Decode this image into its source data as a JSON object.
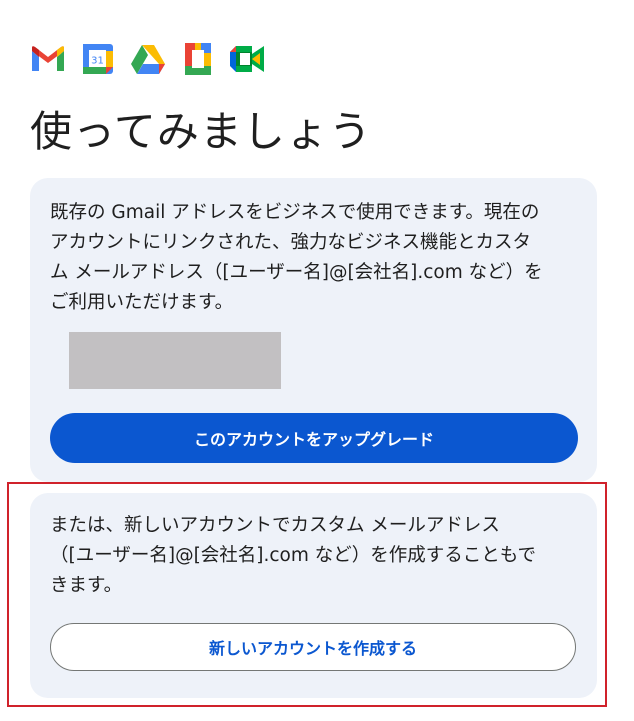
{
  "logos": [
    {
      "name": "gmail-icon"
    },
    {
      "name": "calendar-icon",
      "label": "31"
    },
    {
      "name": "drive-icon"
    },
    {
      "name": "docs-icon"
    },
    {
      "name": "meet-icon"
    }
  ],
  "page_title": "使ってみましょう",
  "upgrade_card": {
    "lines": [
      "既存の Gmail アドレスをビジネスで使用できます。現在の",
      "アカウントにリンクされた、強力なビジネス機能とカスタ",
      "ム メールアドレス（[ユーザー名]@[会社名].com など）を",
      "ご利用いただけます。"
    ],
    "button_label": "このアカウントをアップグレード"
  },
  "new_account_card": {
    "lines": [
      "または、新しいアカウントでカスタム メールアドレス",
      "（[ユーザー名]@[会社名].com など）を作成することもで",
      "きます。"
    ],
    "button_label": "新しいアカウントを作成する"
  },
  "colors": {
    "primary": "#0b57d0",
    "card_bg": "#eef2f9",
    "highlight": "#d0222b",
    "redacted": "#c2c0c2"
  }
}
